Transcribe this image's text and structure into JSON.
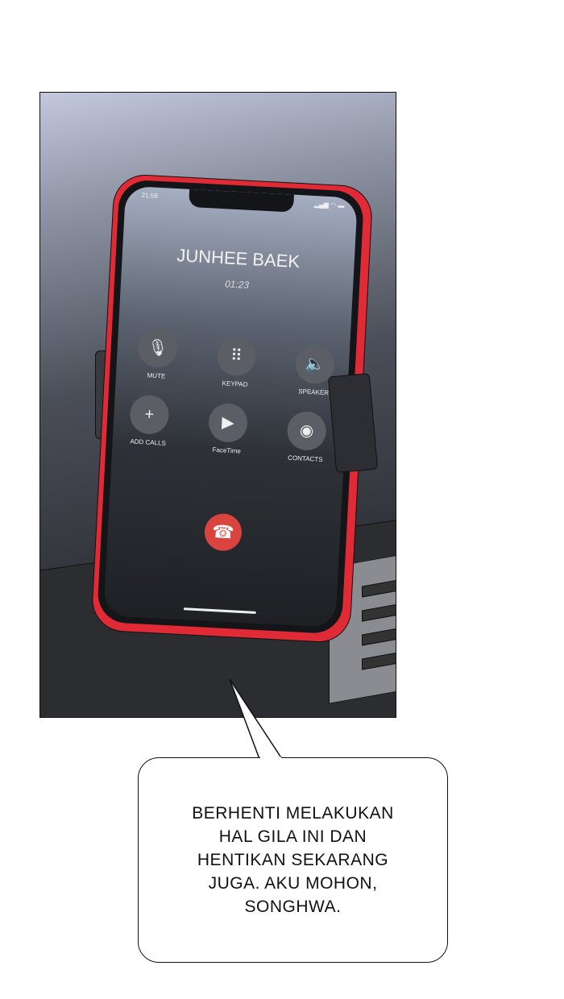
{
  "phone": {
    "status_time": "21:58",
    "status_icons": [
      "signal-icon",
      "wifi-icon",
      "battery-icon"
    ],
    "caller_name": "JUNHEE BAEK",
    "call_duration": "01:23",
    "buttons": [
      {
        "label": "MUTE",
        "icon": "mic-off-icon",
        "glyph": "🎙"
      },
      {
        "label": "KEYPAD",
        "icon": "keypad-icon",
        "glyph": "⠿"
      },
      {
        "label": "SPEAKER",
        "icon": "speaker-icon",
        "glyph": "🔈"
      },
      {
        "label": "ADD CALLS",
        "icon": "plus-icon",
        "glyph": "+"
      },
      {
        "label": "FaceTime",
        "icon": "facetime-icon",
        "glyph": "▶"
      },
      {
        "label": "CONTACTS",
        "icon": "contact-icon",
        "glyph": "◉"
      }
    ],
    "end_call_glyph": "☎",
    "end_call_color": "#d9443f",
    "frame_color": "#e02a35"
  },
  "speech_bubble": {
    "text": "BERHENTI MELAKUKAN HAL GILA INI DAN HENTIKAN SEKARANG JUGA. AKU MOHON, SONGHWA."
  }
}
